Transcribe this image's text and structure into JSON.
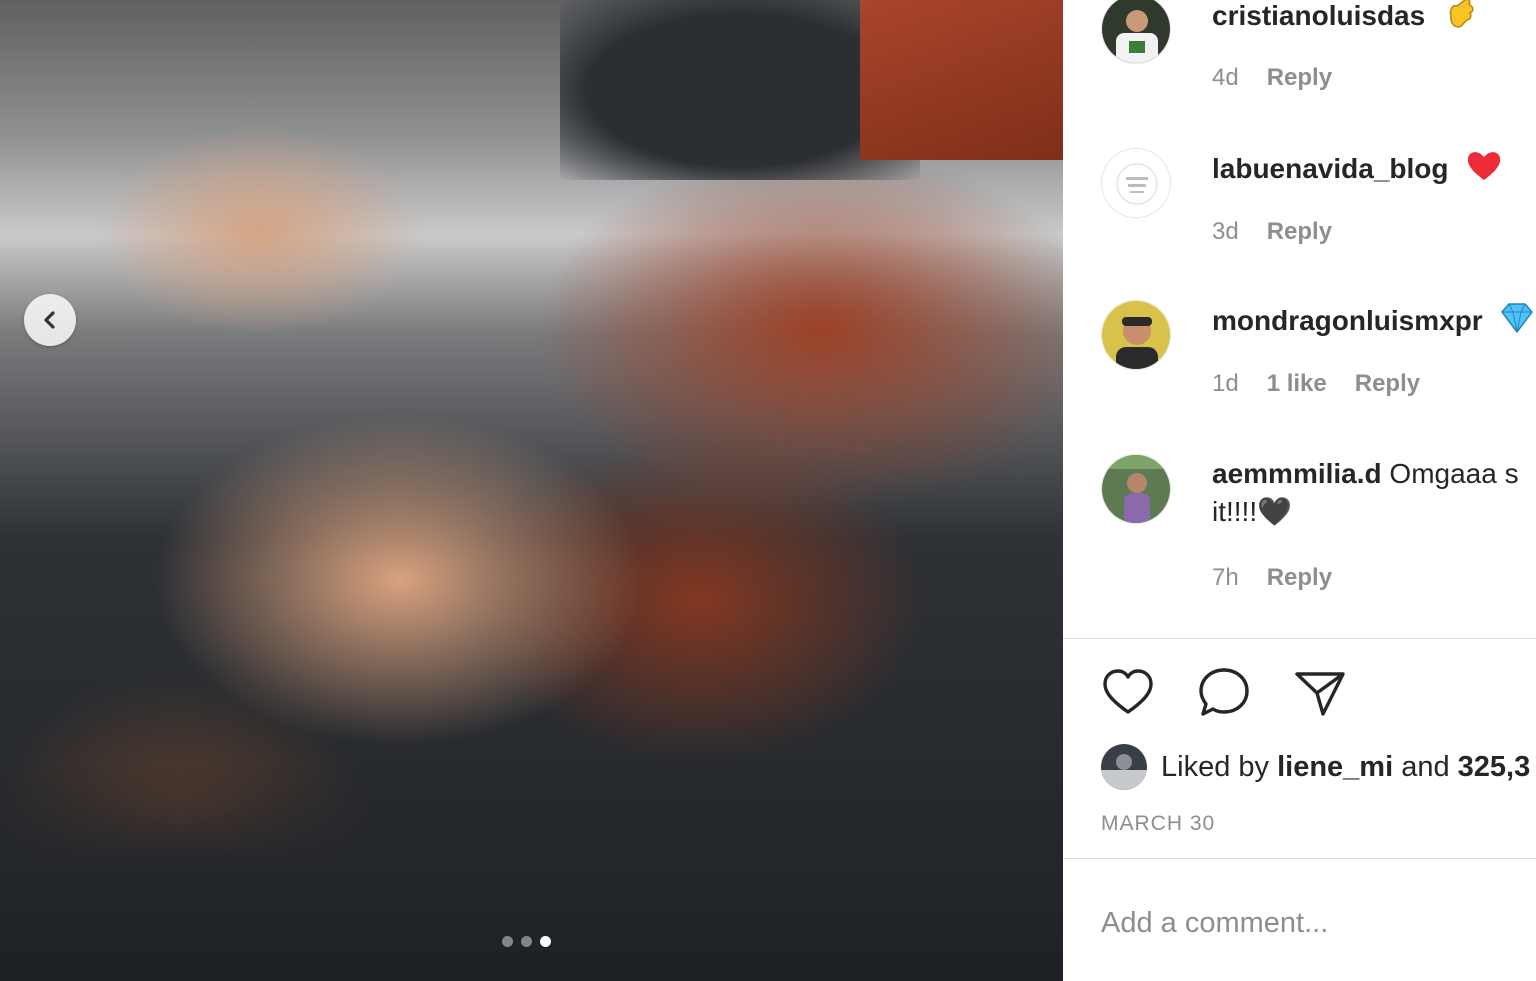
{
  "carousel": {
    "prev_icon": "chevron-left-icon",
    "dot_count": 3,
    "active_dot_index": 2
  },
  "comments": [
    {
      "username": "cristianoluisdas",
      "text": "",
      "emoji": "clapping-hand-icon",
      "time": "4d",
      "likes": "",
      "reply": "Reply"
    },
    {
      "username": "labuenavida_blog",
      "text": "",
      "emoji": "red-heart-icon",
      "time": "3d",
      "likes": "",
      "reply": "Reply"
    },
    {
      "username": "mondragonluismxpr",
      "text": "",
      "emoji": "gem-icon",
      "time": "1d",
      "likes": "1 like",
      "reply": "Reply"
    },
    {
      "username": "aemmmilia.d",
      "text": "Omgaaa s",
      "text_line2": "it!!!!🖤",
      "time": "7h",
      "likes": "",
      "reply": "Reply"
    }
  ],
  "actions": {
    "like_icon": "heart-outline-icon",
    "comment_icon": "comment-bubble-icon",
    "share_icon": "paper-plane-icon"
  },
  "likes": {
    "prefix": "Liked by",
    "user": "liene_mi",
    "connector": "and",
    "count": "325,3"
  },
  "post_date": "MARCH 30",
  "comment_input": {
    "placeholder": "Add a comment..."
  },
  "colors": {
    "text": "#262626",
    "secondary": "#8e8e8e",
    "divider": "#dbdbdb",
    "heart_red": "#ed2c3a",
    "gem_blue": "#4fc3f7",
    "clap_yellow": "#f7c325"
  }
}
